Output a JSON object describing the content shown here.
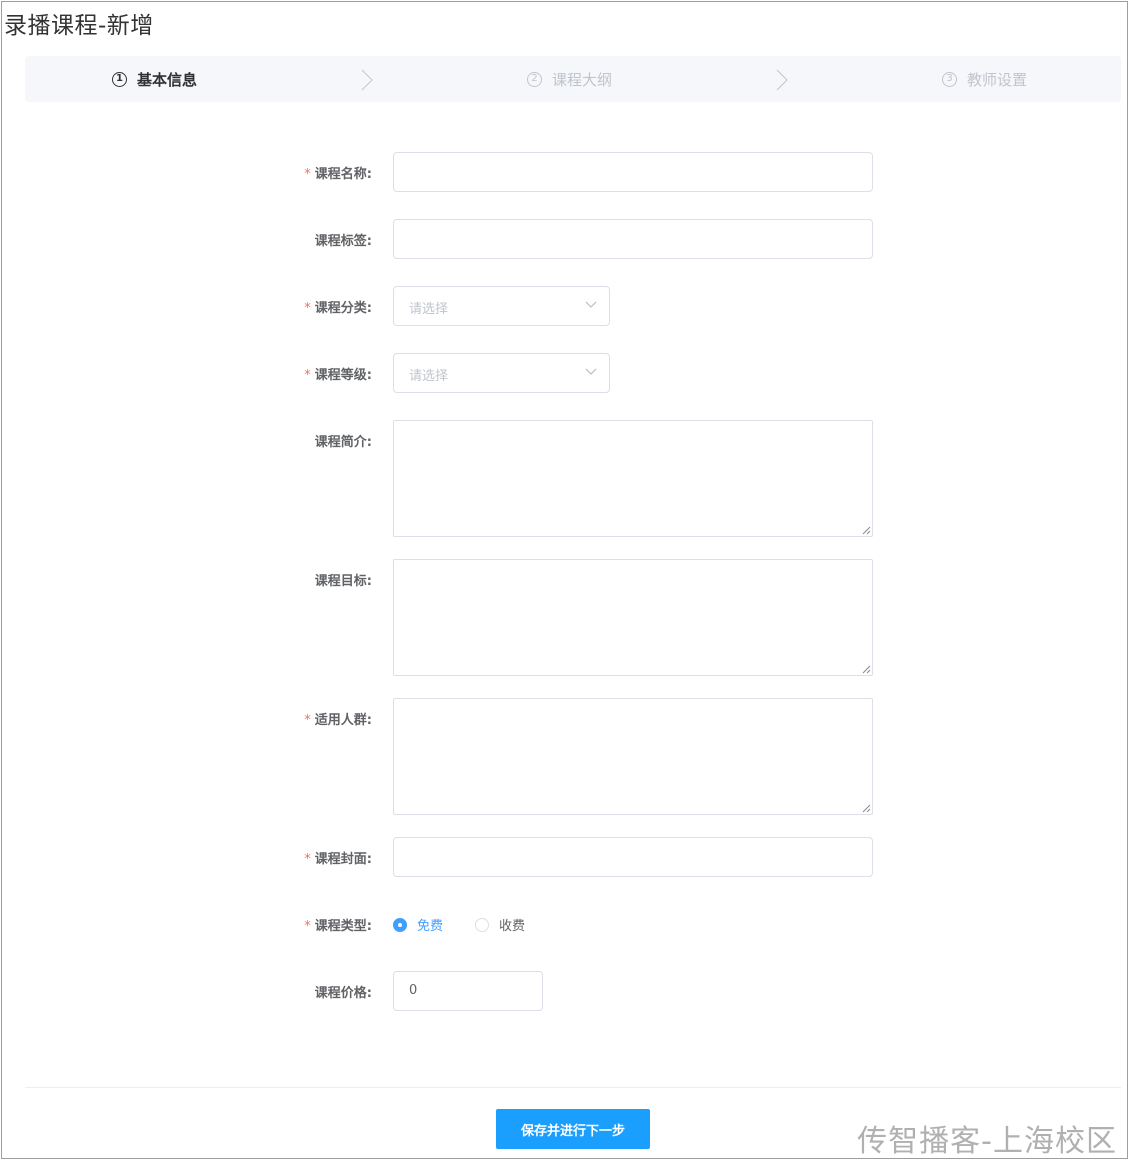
{
  "page": {
    "title": "录播课程-新增"
  },
  "steps": [
    {
      "num": "1",
      "label": "基本信息",
      "active": true
    },
    {
      "num": "2",
      "label": "课程大纲",
      "active": false
    },
    {
      "num": "3",
      "label": "教师设置",
      "active": false
    }
  ],
  "form": {
    "name": {
      "label": "课程名称:",
      "required": "*",
      "value": ""
    },
    "tags": {
      "label": "课程标签:",
      "value": ""
    },
    "category": {
      "label": "课程分类:",
      "required": "*",
      "placeholder": "请选择"
    },
    "grade": {
      "label": "课程等级:",
      "required": "*",
      "placeholder": "请选择"
    },
    "intro": {
      "label": "课程简介:"
    },
    "goal": {
      "label": "课程目标:"
    },
    "audience": {
      "label": "适用人群:",
      "required": "*"
    },
    "cover": {
      "label": "课程封面:",
      "required": "*"
    },
    "type": {
      "label": "课程类型:",
      "required": "*",
      "options": [
        "免费",
        "收费"
      ],
      "selected": "免费"
    },
    "price": {
      "label": "课程价格:",
      "value": "0"
    }
  },
  "actions": {
    "submit_label": "保存并进行下一步"
  },
  "watermark": "传智播客-上海校区",
  "colors": {
    "primary": "#409eff",
    "button": "#1a9fff",
    "required": "#f56c6c"
  }
}
